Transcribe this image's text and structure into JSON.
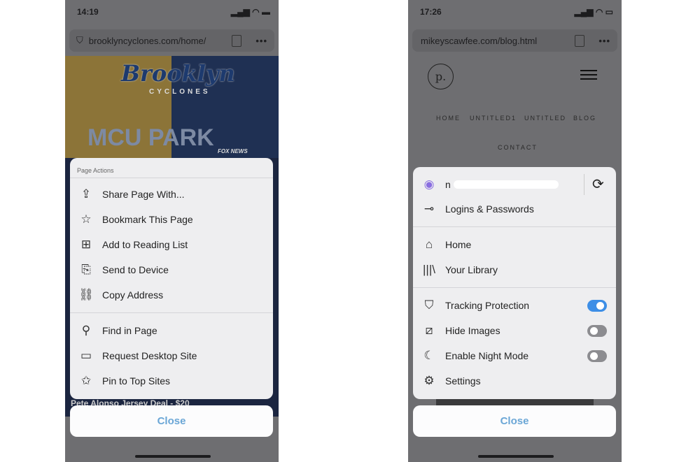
{
  "left": {
    "status": {
      "time": "14:19"
    },
    "url": "brooklyncyclones.com/home/",
    "page": {
      "logo_title": "Brooklyn",
      "logo_subtitle": "CYCLONES",
      "park": "MCU PARK",
      "tagline": "FOX NEWS",
      "bottom_text": "Pete Alonso Jersey Deal - $20"
    },
    "menu": {
      "header": "Page Actions",
      "items": [
        {
          "label": "Share Page With...",
          "icon": "share-icon"
        },
        {
          "label": "Bookmark This Page",
          "icon": "star-icon"
        },
        {
          "label": "Add to Reading List",
          "icon": "reading-list-icon"
        },
        {
          "label": "Send to Device",
          "icon": "send-to-device-icon"
        },
        {
          "label": "Copy Address",
          "icon": "link-icon"
        },
        {
          "label": "Find in Page",
          "icon": "search-icon"
        },
        {
          "label": "Request Desktop Site",
          "icon": "laptop-icon"
        },
        {
          "label": "Pin to Top Sites",
          "icon": "pin-icon"
        }
      ]
    },
    "close": "Close"
  },
  "right": {
    "status": {
      "time": "17:26"
    },
    "url": "mikeyscawfee.com/blog.html",
    "page": {
      "logo": "p.",
      "nav": [
        "HOME",
        "UNTITLED1",
        "UNTITLED",
        "BLOG",
        "CONTACT"
      ]
    },
    "menu": {
      "account": "n",
      "items": [
        {
          "label": "Logins & Passwords",
          "icon": "key-icon"
        },
        {
          "label": "Home",
          "icon": "home-icon"
        },
        {
          "label": "Your Library",
          "icon": "library-icon"
        },
        {
          "label": "Tracking Protection",
          "icon": "shield-icon",
          "toggle": true
        },
        {
          "label": "Hide Images",
          "icon": "hide-images-icon",
          "toggle": false
        },
        {
          "label": "Enable Night Mode",
          "icon": "moon-icon",
          "toggle": false
        },
        {
          "label": "Settings",
          "icon": "gear-icon"
        }
      ]
    },
    "close": "Close"
  },
  "colors": {
    "accent": "#3d8ee6",
    "close_text": "#6aa6d6"
  }
}
